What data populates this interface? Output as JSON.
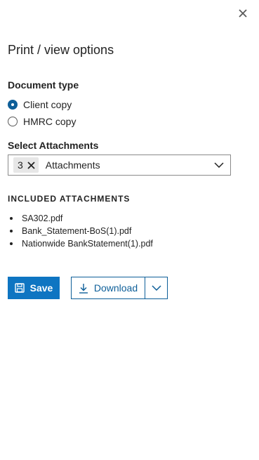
{
  "dialog": {
    "title": "Print / view options",
    "close_icon": "close-icon"
  },
  "document_type": {
    "label": "Document type",
    "options": [
      {
        "label": "Client copy",
        "selected": true
      },
      {
        "label": "HMRC copy",
        "selected": false
      }
    ]
  },
  "attachments_select": {
    "label": "Select Attachments",
    "count": "3",
    "value": "Attachments",
    "icons": {
      "remove": "x-icon",
      "expand": "chevron-down-icon"
    }
  },
  "included": {
    "heading": "INCLUDED ATTACHMENTS",
    "items": [
      "SA302.pdf",
      "Bank_Statement-BoS(1).pdf",
      "Nationwide BankStatement(1).pdf"
    ]
  },
  "actions": {
    "save_label": "Save",
    "save_icon": "floppy-disk-icon",
    "download_label": "Download",
    "download_icon": "download-icon",
    "download_menu_icon": "chevron-down-icon"
  },
  "colors": {
    "primary": "#0e75c2",
    "primary_dark": "#0e5f99",
    "text": "#232323",
    "chip_bg": "#e7e7e7"
  }
}
